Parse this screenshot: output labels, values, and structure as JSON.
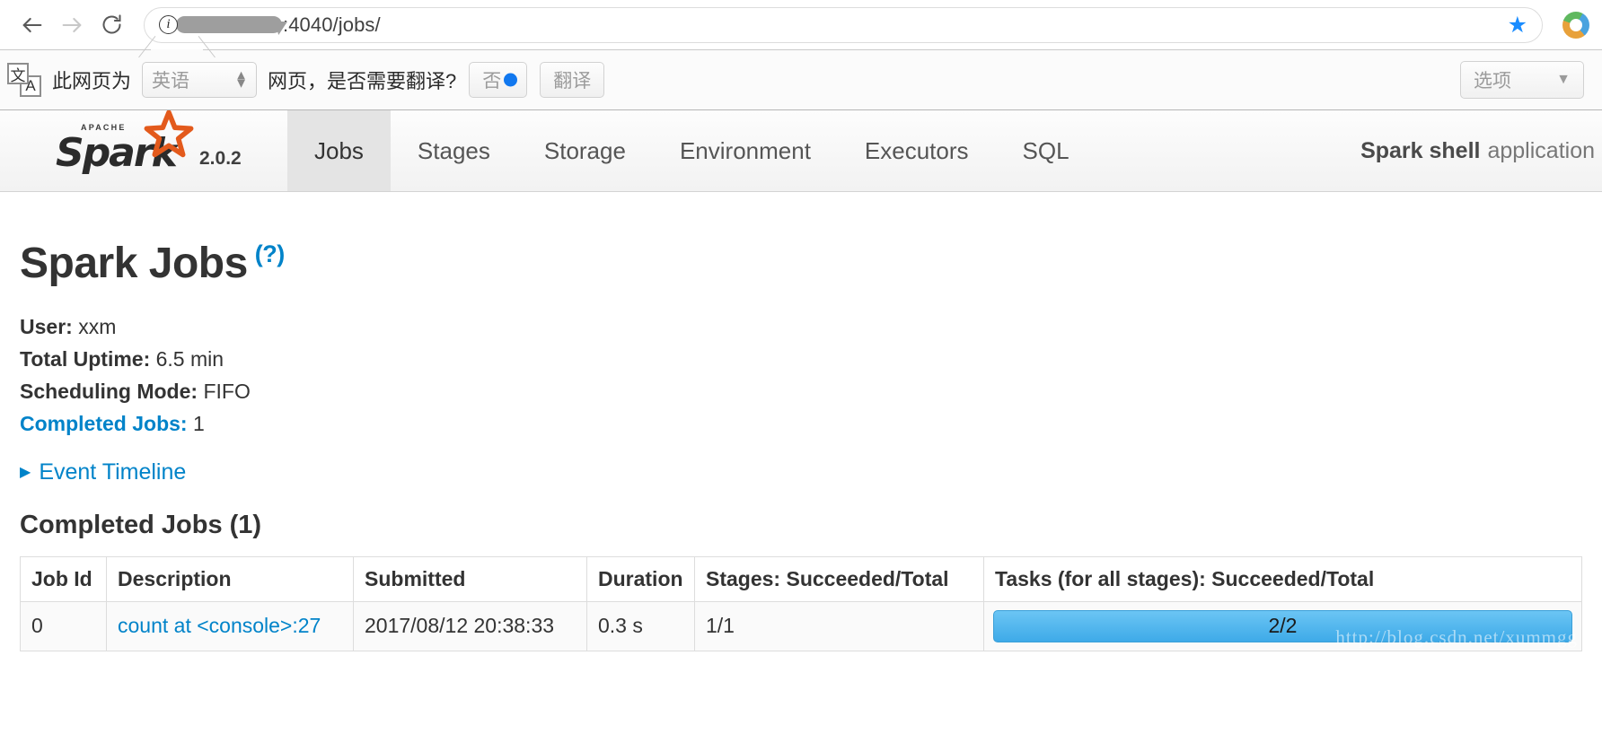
{
  "browser": {
    "back_label": "back",
    "forward_label": "forward",
    "reload_label": "reload",
    "url_suffix": ":4040/jobs/",
    "url_redacted": "",
    "bookmark_label": "bookmark"
  },
  "translate_bar": {
    "glyph_front": "文",
    "glyph_back": "A",
    "prefix_text": "此网页为",
    "language": "英语",
    "suffix_text": "网页，是否需要翻译?",
    "decline_label": "否",
    "translate_label": "翻译",
    "options_label": "选项"
  },
  "spark_nav": {
    "apache_tag": "APACHE",
    "logo_word": "Spark",
    "version": "2.0.2",
    "tabs": [
      {
        "label": "Jobs",
        "active": true
      },
      {
        "label": "Stages",
        "active": false
      },
      {
        "label": "Storage",
        "active": false
      },
      {
        "label": "Environment",
        "active": false
      },
      {
        "label": "Executors",
        "active": false
      },
      {
        "label": "SQL",
        "active": false
      }
    ],
    "app_name_bold": "Spark shell",
    "app_name_rest": "application"
  },
  "page": {
    "title": "Spark Jobs",
    "help_link": "(?)",
    "summary": {
      "user_label": "User:",
      "user_value": "xxm",
      "uptime_label": "Total Uptime:",
      "uptime_value": "6.5 min",
      "scheduling_label": "Scheduling Mode:",
      "scheduling_value": "FIFO",
      "completed_label": "Completed Jobs:",
      "completed_value": "1"
    },
    "event_timeline_caret": "▶",
    "event_timeline_label": "Event Timeline",
    "section_title": "Completed Jobs (1)"
  },
  "jobs_table": {
    "columns": [
      "Job Id",
      "Description",
      "Submitted",
      "Duration",
      "Stages: Succeeded/Total",
      "Tasks (for all stages): Succeeded/Total"
    ],
    "rows": [
      {
        "job_id": "0",
        "description": "count at <console>:27",
        "submitted": "2017/08/12 20:38:33",
        "duration": "0.3 s",
        "stages": "1/1",
        "tasks_label": "2/2",
        "tasks_percent": 100
      }
    ]
  },
  "watermark": "http://blog.csdn.net/xummgg",
  "colors": {
    "link_blue": "#0083c9",
    "progress_blue": "#3eaae8",
    "spark_orange": "#e35a1c",
    "active_tab_bg": "#e4e4e4"
  }
}
